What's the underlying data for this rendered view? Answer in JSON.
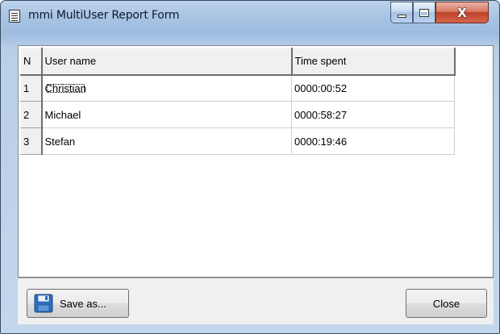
{
  "window": {
    "title": "mmi MultiUser Report Form"
  },
  "table": {
    "columns": [
      "N",
      "User name",
      "Time spent"
    ],
    "rows": [
      {
        "n": "1",
        "user": "Christian",
        "time": "0000:00:52"
      },
      {
        "n": "2",
        "user": "Michael",
        "time": "0000:58:27"
      },
      {
        "n": "3",
        "user": "Stefan",
        "time": "0000:19:46"
      }
    ]
  },
  "buttons": {
    "save_label": "Save as...",
    "close_label": "Close"
  },
  "icons": {
    "app": "report-document-icon",
    "minimize": "minimize-icon",
    "maximize": "maximize-icon",
    "close": "close-icon",
    "save": "floppy-disk-icon"
  },
  "colors": {
    "close_button": "#c0402a",
    "title_bar": "#a9c4e3"
  }
}
